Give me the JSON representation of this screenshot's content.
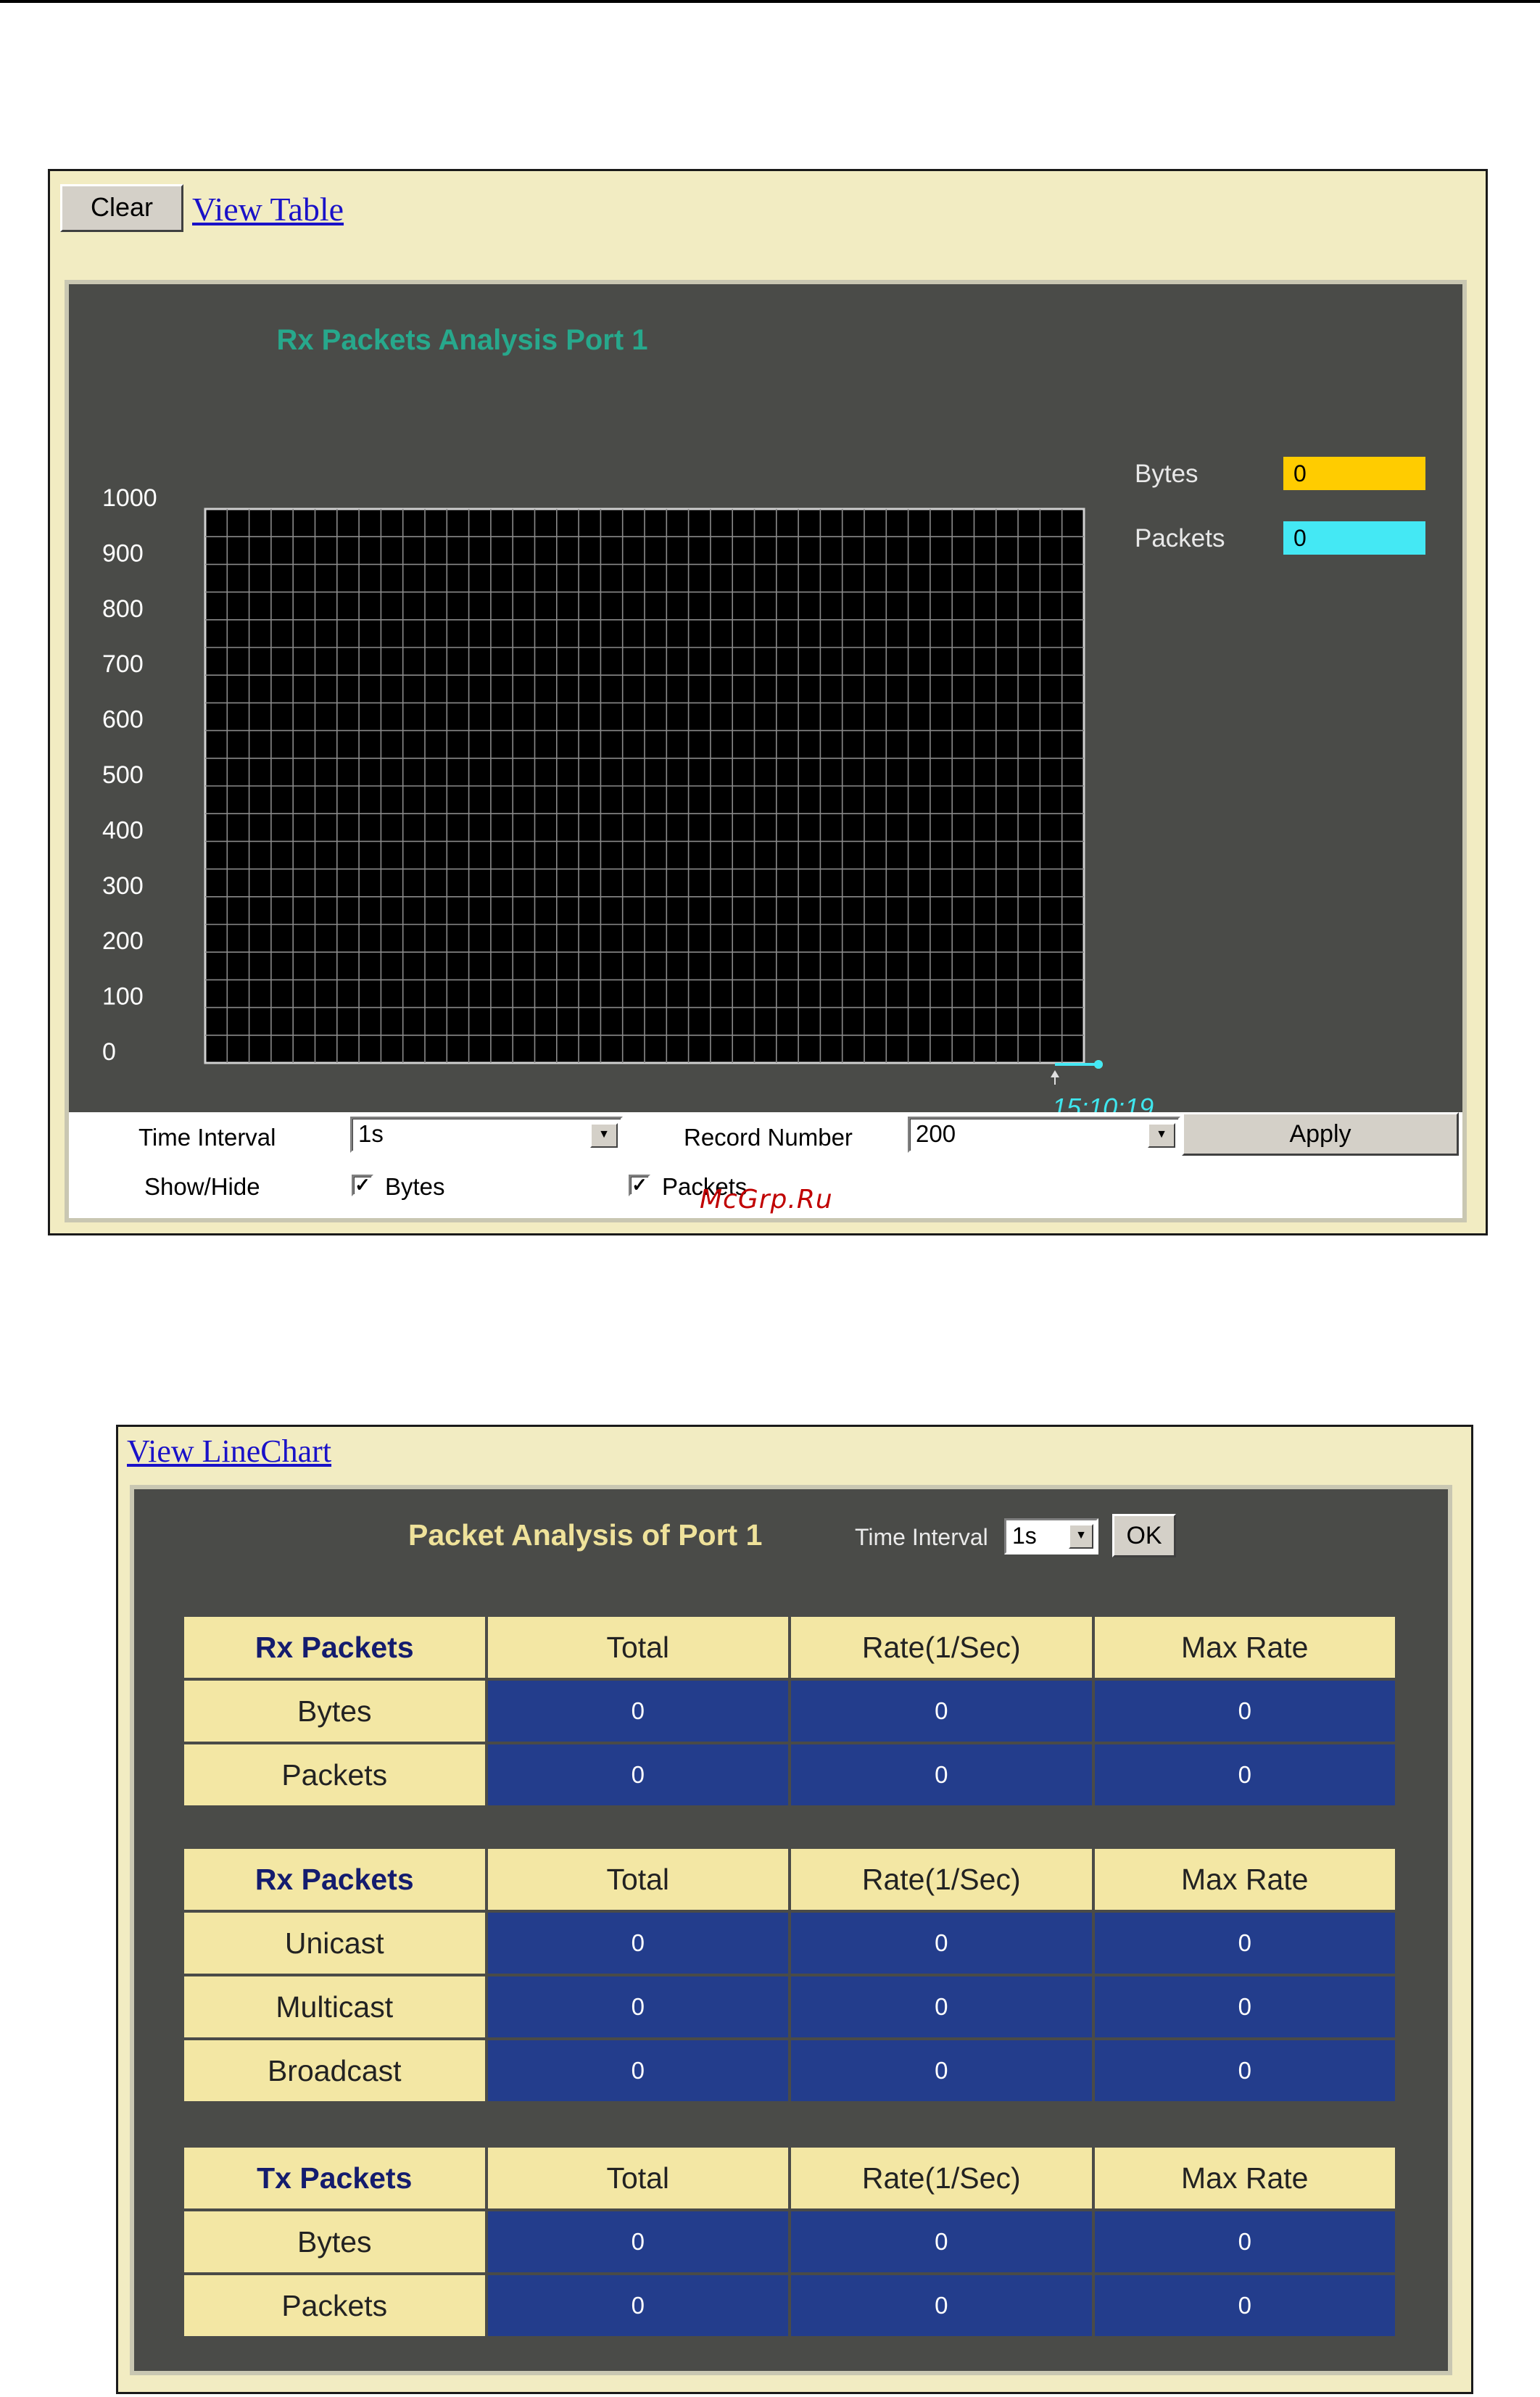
{
  "linechart_panel": {
    "clear_label": "Clear",
    "view_table_link": "View Table",
    "chart_title": "Rx Packets Analysis   Port 1",
    "legend": [
      {
        "name": "Bytes",
        "value": "0",
        "color": "#ffcc00"
      },
      {
        "name": "Packets",
        "value": "0",
        "color": "#44e8f4"
      }
    ],
    "time_marker": "15:10:19",
    "controls": {
      "time_interval_label": "Time Interval",
      "time_interval_value": "1s",
      "record_number_label": "Record Number",
      "record_number_value": "200",
      "apply_label": "Apply",
      "show_hide_label": "Show/Hide",
      "show_bytes_label": "Bytes",
      "show_bytes_checked": true,
      "show_packets_label": "Packets",
      "show_packets_checked": true
    },
    "watermark": "McGrp.Ru"
  },
  "chart_data": {
    "type": "line",
    "title": "Rx Packets Analysis   Port 1",
    "ylim": [
      0,
      1000
    ],
    "yticks": [
      "1000",
      "900",
      "800",
      "700",
      "600",
      "500",
      "400",
      "300",
      "200",
      "100",
      "0"
    ],
    "x": [
      "15:10:19"
    ],
    "series": [
      {
        "name": "Bytes",
        "values": [
          0
        ],
        "color": "#ffcc00"
      },
      {
        "name": "Packets",
        "values": [
          0
        ],
        "color": "#44e8f4"
      }
    ],
    "grid": true,
    "legend_position": "right"
  },
  "table_panel": {
    "view_linechart_link": "View LineChart",
    "title": "Packet Analysis of Port 1",
    "time_interval_label": "Time Interval",
    "time_interval_value": "1s",
    "ok_label": "OK",
    "tables": [
      {
        "headers": [
          "Rx Packets",
          "Total",
          "Rate(1/Sec)",
          "Max Rate"
        ],
        "rows": [
          [
            "Bytes",
            "0",
            "0",
            "0"
          ],
          [
            "Packets",
            "0",
            "0",
            "0"
          ]
        ]
      },
      {
        "headers": [
          "Rx Packets",
          "Total",
          "Rate(1/Sec)",
          "Max Rate"
        ],
        "rows": [
          [
            "Unicast",
            "0",
            "0",
            "0"
          ],
          [
            "Multicast",
            "0",
            "0",
            "0"
          ],
          [
            "Broadcast",
            "0",
            "0",
            "0"
          ]
        ]
      },
      {
        "headers": [
          "Tx Packets",
          "Total",
          "Rate(1/Sec)",
          "Max Rate"
        ],
        "rows": [
          [
            "Bytes",
            "0",
            "0",
            "0"
          ],
          [
            "Packets",
            "0",
            "0",
            "0"
          ]
        ]
      }
    ]
  }
}
